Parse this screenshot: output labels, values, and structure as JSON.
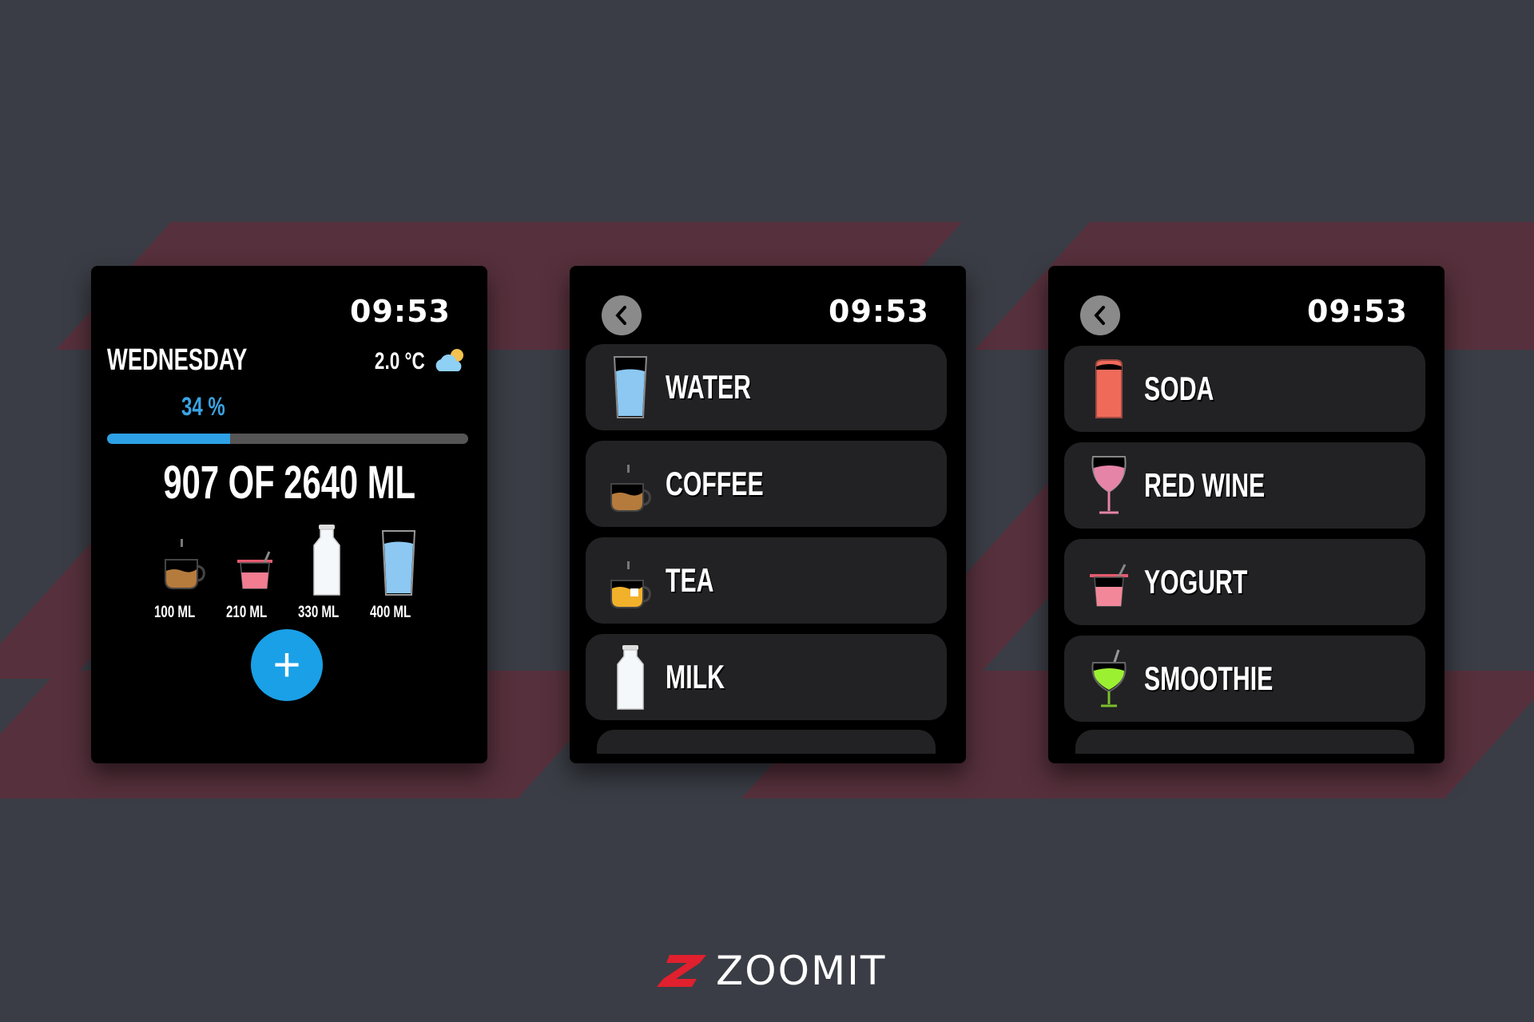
{
  "brand": {
    "name": "ZOOMIT",
    "accent": "#e0202e"
  },
  "colors": {
    "background": "#3a3d45",
    "stripe": "#56303c",
    "progress": "#2ea0e6",
    "row": "#222224"
  },
  "screens": {
    "home": {
      "time": "09:53",
      "day": "WEDNESDAY",
      "temperature": "2.0 °C",
      "weather_icon": "partly-cloudy-icon",
      "percent_label": "34 %",
      "progress_fraction": 0.34,
      "total_label": "907 OF 2640 ML",
      "quick_add": [
        {
          "icon": "coffee-cup-icon",
          "label": "100 ML"
        },
        {
          "icon": "yogurt-cup-icon",
          "label": "210 ML"
        },
        {
          "icon": "milk-bottle-icon",
          "label": "330 ML"
        },
        {
          "icon": "water-glass-icon",
          "label": "400 ML"
        }
      ],
      "add_button": "+"
    },
    "drinks1": {
      "time": "09:53",
      "items": [
        {
          "icon": "water-glass-icon",
          "label": "WATER"
        },
        {
          "icon": "coffee-cup-icon",
          "label": "COFFEE"
        },
        {
          "icon": "tea-cup-icon",
          "label": "TEA"
        },
        {
          "icon": "milk-bottle-icon",
          "label": "MILK"
        }
      ]
    },
    "drinks2": {
      "time": "09:53",
      "items": [
        {
          "icon": "soda-can-icon",
          "label": "SODA"
        },
        {
          "icon": "wine-glass-icon",
          "label": "RED WINE"
        },
        {
          "icon": "yogurt-cup-icon",
          "label": "YOGURT"
        },
        {
          "icon": "smoothie-glass-icon",
          "label": "SMOOTHIE"
        }
      ]
    }
  }
}
